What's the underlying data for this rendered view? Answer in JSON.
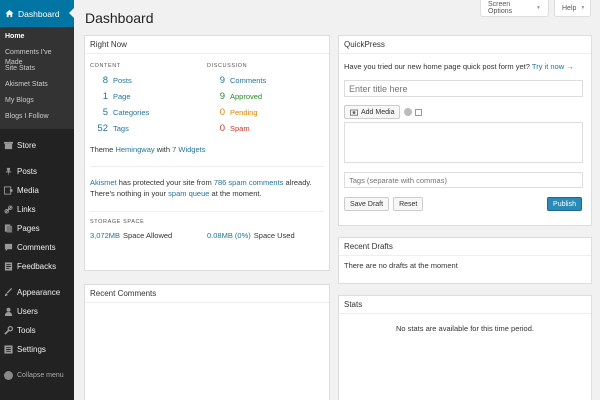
{
  "sidebar": {
    "dashboard_label": "Dashboard",
    "sub_items": [
      "Home",
      "Comments I've Made",
      "Site Stats",
      "Akismet Stats",
      "My Blogs",
      "Blogs I Follow"
    ],
    "store_label": "Store",
    "menu_a": [
      "Posts",
      "Media",
      "Links",
      "Pages",
      "Comments",
      "Feedbacks"
    ],
    "menu_b": [
      "Appearance",
      "Users",
      "Tools",
      "Settings"
    ],
    "collapse_label": "Collapse menu"
  },
  "header": {
    "title": "Dashboard",
    "screen_options": "Screen Options",
    "help": "Help"
  },
  "right_now": {
    "title": "Right Now",
    "content_head": "CONTENT",
    "discussion_head": "DISCUSSION",
    "content": [
      {
        "num": "8",
        "label": "Posts"
      },
      {
        "num": "1",
        "label": "Page"
      },
      {
        "num": "5",
        "label": "Categories"
      },
      {
        "num": "52",
        "label": "Tags"
      }
    ],
    "discussion": [
      {
        "num": "9",
        "label": "Comments"
      },
      {
        "num": "9",
        "label": "Approved"
      },
      {
        "num": "0",
        "label": "Pending"
      },
      {
        "num": "0",
        "label": "Spam"
      }
    ],
    "theme_prefix": "Theme ",
    "theme_name": "Hemingway",
    "theme_mid": " with ",
    "widgets": "7 Widgets",
    "akismet_link": "Akismet",
    "akismet_text1": " has protected your site from ",
    "spam_count": "786 spam comments",
    "akismet_text2": " already. There's nothing in your ",
    "spam_queue": "spam queue",
    "akismet_text3": " at the moment.",
    "storage_head": "STORAGE SPACE",
    "allowed_value": "3,072MB",
    "allowed_label": "Space Allowed",
    "used_value": "0.08MB (0%)",
    "used_label": "Space Used"
  },
  "recent_comments": {
    "title": "Recent Comments"
  },
  "quickpress": {
    "title": "QuickPress",
    "prompt": "Have you tried our new home page quick post form yet?",
    "try_link": "Try it now →",
    "title_placeholder": "Enter title here",
    "add_media": "Add Media",
    "tags_placeholder": "Tags (separate with commas)",
    "save_draft": "Save Draft",
    "reset": "Reset",
    "publish": "Publish"
  },
  "recent_drafts": {
    "title": "Recent Drafts",
    "empty": "There are no drafts at the moment"
  },
  "stats": {
    "title": "Stats",
    "empty": "No stats are available for this time period."
  }
}
